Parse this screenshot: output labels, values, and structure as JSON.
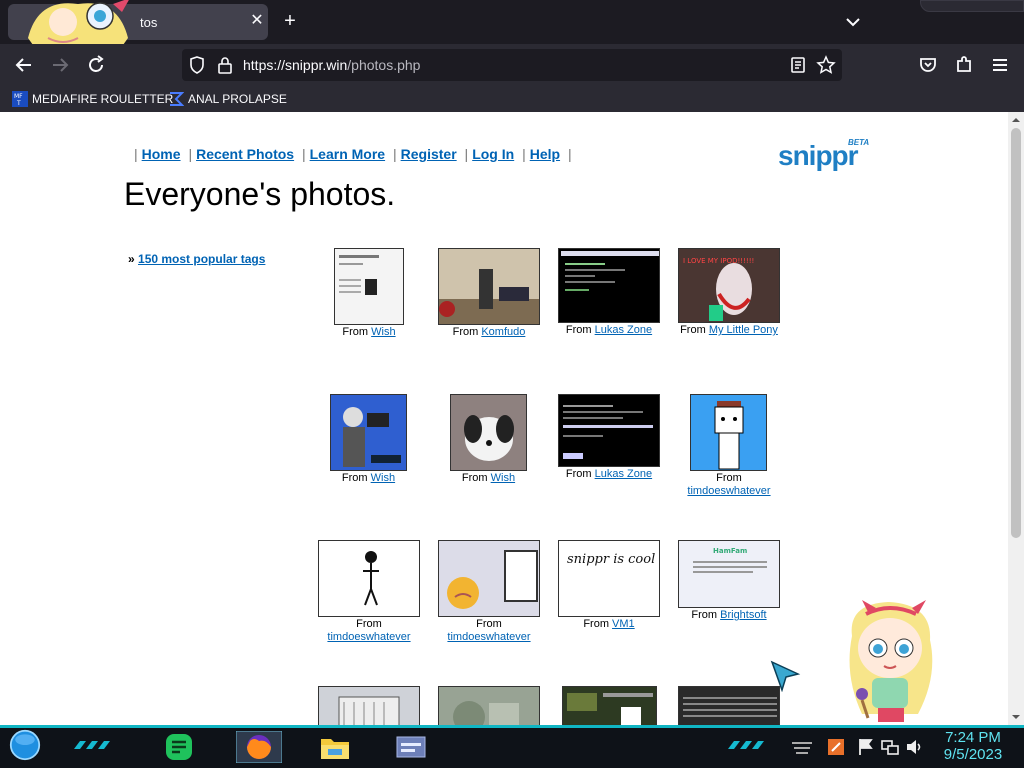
{
  "browser": {
    "tab_title": "tos",
    "tab_close": "✕",
    "new_tab": "+",
    "url_host": "https://snippr.win",
    "url_path": "/photos.php",
    "bookmarks": [
      {
        "label": "MEDIAFIRE ROULETTER",
        "icon": "mediafire-icon"
      },
      {
        "label": "ANAL PROLAPSE",
        "icon": "sigma-icon"
      }
    ]
  },
  "page": {
    "nav": [
      {
        "label": "Home"
      },
      {
        "label": "Recent Photos"
      },
      {
        "label": "Learn More"
      },
      {
        "label": "Register"
      },
      {
        "label": "Log In"
      },
      {
        "label": "Help"
      }
    ],
    "nav_separator": "|",
    "logo": {
      "text": "snippr",
      "beta": "BETA"
    },
    "title": "Everyone's photos.",
    "tags_prefix": "»",
    "tags_link": "150 most popular tags",
    "from_label": "From",
    "photos": [
      {
        "source": "Wish"
      },
      {
        "source": "Komfudo"
      },
      {
        "source": "Lukas Zone"
      },
      {
        "source": "My Little Pony"
      },
      {
        "source": "Wish"
      },
      {
        "source": "Wish"
      },
      {
        "source": "Lukas Zone"
      },
      {
        "source": "timdoeswhatever"
      },
      {
        "source": "timdoeswhatever"
      },
      {
        "source": "timdoeswhatever"
      },
      {
        "source": "VM1"
      },
      {
        "source": "Brightsoft"
      }
    ],
    "thumb_texts": {
      "pony": "I LOVE MY IPOD!!!!!!",
      "snippr_cool": "snippr is cool -/s/",
      "brightsoft": "HamFam"
    }
  },
  "taskbar": {
    "time": "7:24 PM",
    "date": "9/5/2023"
  },
  "colors": {
    "link": "#0063b4",
    "logo": "#1f7fc4",
    "accent": "#10b6c4"
  }
}
